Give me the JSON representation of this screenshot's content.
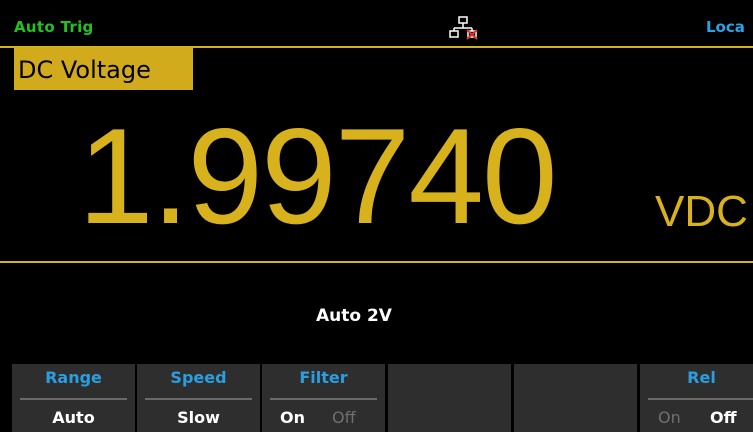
{
  "status_bar": {
    "trigger_mode": "Auto Trig",
    "lan_icon": "network-disconnected-icon",
    "remote_state": "Loca"
  },
  "measurement": {
    "function": "DC Voltage",
    "reading": "1.99740",
    "unit": "VDC",
    "range_status": "Auto  2V"
  },
  "softkeys": {
    "range": {
      "title": "Range",
      "value": "Auto"
    },
    "speed": {
      "title": "Speed",
      "value": "Slow"
    },
    "filter": {
      "title": "Filter",
      "on_label": "On",
      "off_label": "Off",
      "selected": "On"
    },
    "rel": {
      "title": "Rel",
      "on_label": "On",
      "off_label": "Off",
      "selected": "Off"
    }
  },
  "colors": {
    "accent_yellow": "#d6b21a",
    "trigger_green": "#22c31e",
    "label_blue": "#2a9ee0",
    "softkey_bg": "#2e2e2e"
  }
}
